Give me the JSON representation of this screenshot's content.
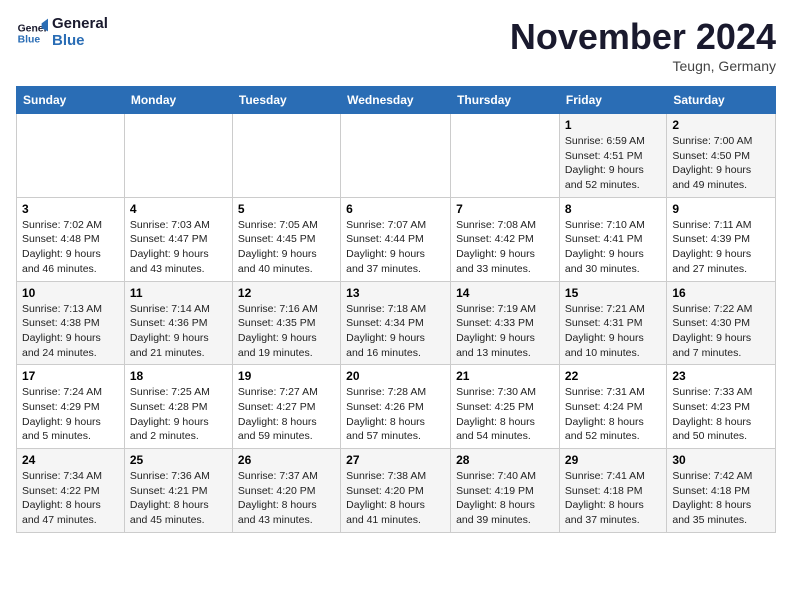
{
  "header": {
    "logo_line1": "General",
    "logo_line2": "Blue",
    "month_title": "November 2024",
    "location": "Teugn, Germany"
  },
  "weekdays": [
    "Sunday",
    "Monday",
    "Tuesday",
    "Wednesday",
    "Thursday",
    "Friday",
    "Saturday"
  ],
  "weeks": [
    [
      {
        "day": "",
        "info": ""
      },
      {
        "day": "",
        "info": ""
      },
      {
        "day": "",
        "info": ""
      },
      {
        "day": "",
        "info": ""
      },
      {
        "day": "",
        "info": ""
      },
      {
        "day": "1",
        "info": "Sunrise: 6:59 AM\nSunset: 4:51 PM\nDaylight: 9 hours\nand 52 minutes."
      },
      {
        "day": "2",
        "info": "Sunrise: 7:00 AM\nSunset: 4:50 PM\nDaylight: 9 hours\nand 49 minutes."
      }
    ],
    [
      {
        "day": "3",
        "info": "Sunrise: 7:02 AM\nSunset: 4:48 PM\nDaylight: 9 hours\nand 46 minutes."
      },
      {
        "day": "4",
        "info": "Sunrise: 7:03 AM\nSunset: 4:47 PM\nDaylight: 9 hours\nand 43 minutes."
      },
      {
        "day": "5",
        "info": "Sunrise: 7:05 AM\nSunset: 4:45 PM\nDaylight: 9 hours\nand 40 minutes."
      },
      {
        "day": "6",
        "info": "Sunrise: 7:07 AM\nSunset: 4:44 PM\nDaylight: 9 hours\nand 37 minutes."
      },
      {
        "day": "7",
        "info": "Sunrise: 7:08 AM\nSunset: 4:42 PM\nDaylight: 9 hours\nand 33 minutes."
      },
      {
        "day": "8",
        "info": "Sunrise: 7:10 AM\nSunset: 4:41 PM\nDaylight: 9 hours\nand 30 minutes."
      },
      {
        "day": "9",
        "info": "Sunrise: 7:11 AM\nSunset: 4:39 PM\nDaylight: 9 hours\nand 27 minutes."
      }
    ],
    [
      {
        "day": "10",
        "info": "Sunrise: 7:13 AM\nSunset: 4:38 PM\nDaylight: 9 hours\nand 24 minutes."
      },
      {
        "day": "11",
        "info": "Sunrise: 7:14 AM\nSunset: 4:36 PM\nDaylight: 9 hours\nand 21 minutes."
      },
      {
        "day": "12",
        "info": "Sunrise: 7:16 AM\nSunset: 4:35 PM\nDaylight: 9 hours\nand 19 minutes."
      },
      {
        "day": "13",
        "info": "Sunrise: 7:18 AM\nSunset: 4:34 PM\nDaylight: 9 hours\nand 16 minutes."
      },
      {
        "day": "14",
        "info": "Sunrise: 7:19 AM\nSunset: 4:33 PM\nDaylight: 9 hours\nand 13 minutes."
      },
      {
        "day": "15",
        "info": "Sunrise: 7:21 AM\nSunset: 4:31 PM\nDaylight: 9 hours\nand 10 minutes."
      },
      {
        "day": "16",
        "info": "Sunrise: 7:22 AM\nSunset: 4:30 PM\nDaylight: 9 hours\nand 7 minutes."
      }
    ],
    [
      {
        "day": "17",
        "info": "Sunrise: 7:24 AM\nSunset: 4:29 PM\nDaylight: 9 hours\nand 5 minutes."
      },
      {
        "day": "18",
        "info": "Sunrise: 7:25 AM\nSunset: 4:28 PM\nDaylight: 9 hours\nand 2 minutes."
      },
      {
        "day": "19",
        "info": "Sunrise: 7:27 AM\nSunset: 4:27 PM\nDaylight: 8 hours\nand 59 minutes."
      },
      {
        "day": "20",
        "info": "Sunrise: 7:28 AM\nSunset: 4:26 PM\nDaylight: 8 hours\nand 57 minutes."
      },
      {
        "day": "21",
        "info": "Sunrise: 7:30 AM\nSunset: 4:25 PM\nDaylight: 8 hours\nand 54 minutes."
      },
      {
        "day": "22",
        "info": "Sunrise: 7:31 AM\nSunset: 4:24 PM\nDaylight: 8 hours\nand 52 minutes."
      },
      {
        "day": "23",
        "info": "Sunrise: 7:33 AM\nSunset: 4:23 PM\nDaylight: 8 hours\nand 50 minutes."
      }
    ],
    [
      {
        "day": "24",
        "info": "Sunrise: 7:34 AM\nSunset: 4:22 PM\nDaylight: 8 hours\nand 47 minutes."
      },
      {
        "day": "25",
        "info": "Sunrise: 7:36 AM\nSunset: 4:21 PM\nDaylight: 8 hours\nand 45 minutes."
      },
      {
        "day": "26",
        "info": "Sunrise: 7:37 AM\nSunset: 4:20 PM\nDaylight: 8 hours\nand 43 minutes."
      },
      {
        "day": "27",
        "info": "Sunrise: 7:38 AM\nSunset: 4:20 PM\nDaylight: 8 hours\nand 41 minutes."
      },
      {
        "day": "28",
        "info": "Sunrise: 7:40 AM\nSunset: 4:19 PM\nDaylight: 8 hours\nand 39 minutes."
      },
      {
        "day": "29",
        "info": "Sunrise: 7:41 AM\nSunset: 4:18 PM\nDaylight: 8 hours\nand 37 minutes."
      },
      {
        "day": "30",
        "info": "Sunrise: 7:42 AM\nSunset: 4:18 PM\nDaylight: 8 hours\nand 35 minutes."
      }
    ]
  ]
}
